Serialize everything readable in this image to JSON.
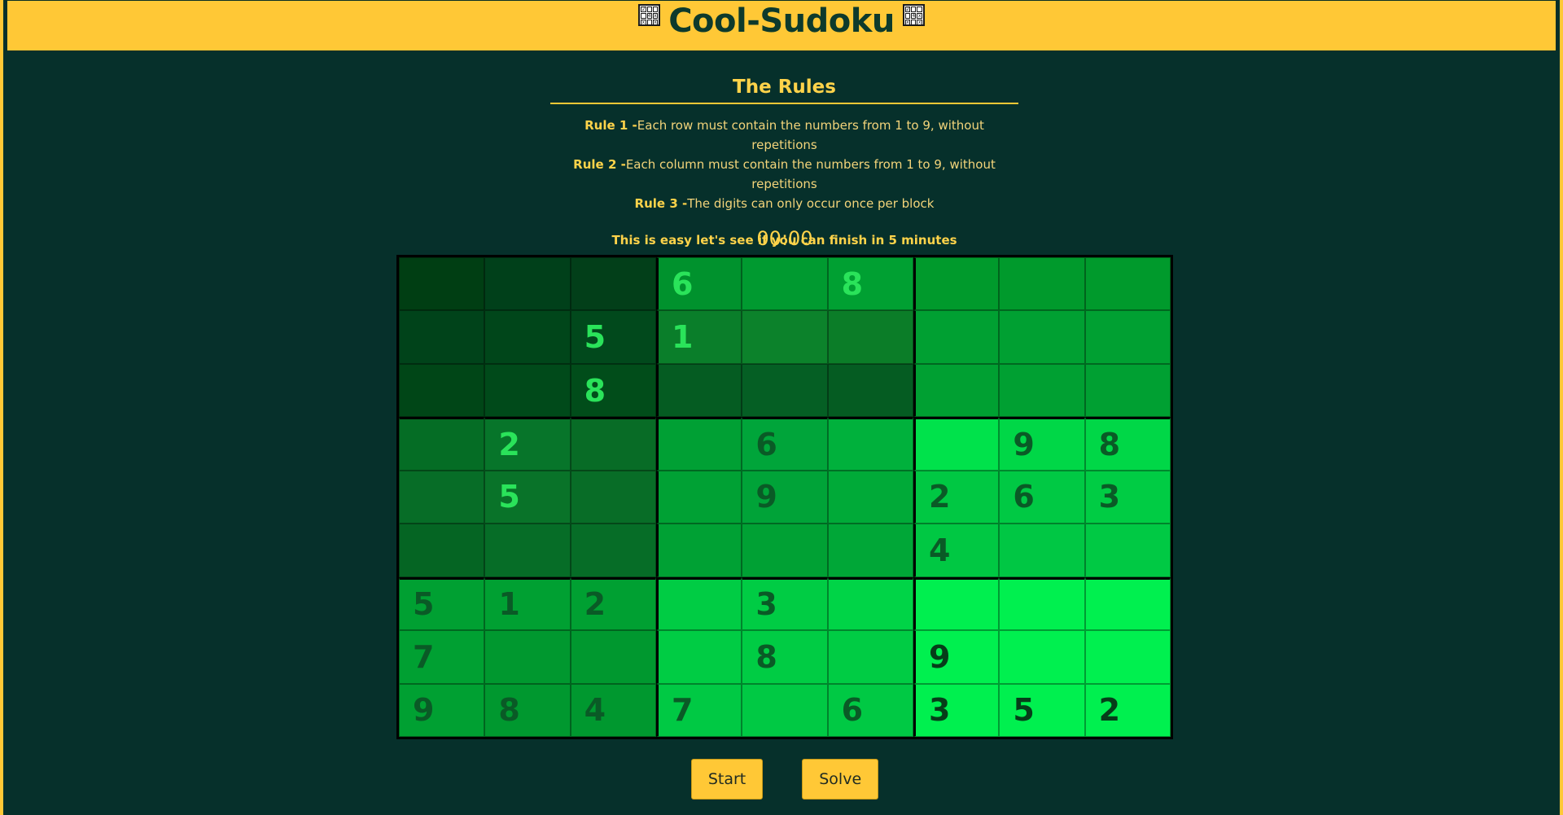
{
  "header": {
    "title": "Cool-Sudoku",
    "icon_glyphs": [
      "2",
      "",
      "",
      "",
      "4",
      "x",
      "x",
      "",
      "x"
    ]
  },
  "rules": {
    "title": "The Rules",
    "items": [
      {
        "label": "Rule 1 -",
        "text": "Each row must contain the numbers from 1 to 9, without repetitions"
      },
      {
        "label": "Rule 2 -",
        "text": "Each column must contain the numbers from 1 to 9, without repetitions"
      },
      {
        "label": "Rule 3 -",
        "text": "The digits can only occur once per block"
      }
    ],
    "tagline": "This is easy let's see if you can finish in 5 minutes"
  },
  "timer": "00:00",
  "board": {
    "cells": [
      [
        "",
        "",
        "",
        "6",
        "",
        "8",
        "",
        "",
        ""
      ],
      [
        "",
        "",
        "5",
        "1",
        "",
        "",
        "",
        "",
        ""
      ],
      [
        "",
        "",
        "8",
        "",
        "",
        "",
        "",
        "",
        ""
      ],
      [
        "",
        "2",
        "",
        "",
        "6",
        "",
        "",
        "9",
        "8"
      ],
      [
        "",
        "5",
        "",
        "",
        "9",
        "",
        "2",
        "6",
        "3"
      ],
      [
        "",
        "",
        "",
        "",
        "",
        "",
        "4",
        "",
        ""
      ],
      [
        "5",
        "1",
        "2",
        "",
        "3",
        "",
        "",
        "",
        ""
      ],
      [
        "7",
        "",
        "",
        "",
        "8",
        "",
        "9",
        "",
        ""
      ],
      [
        "9",
        "8",
        "4",
        "7",
        "",
        "6",
        "3",
        "5",
        "2"
      ]
    ],
    "palette": {
      "backgrounds": [
        "#003d14",
        "#00461a",
        "#055c22",
        "#045c21",
        "#00922d",
        "#00a03a",
        "#00b63a",
        "#00c745",
        "#00e84c",
        "#00d647",
        "#00cc44",
        "#00f04f"
      ],
      "digit_bright": "#2ae35a",
      "digit_dark": "#0a5a26"
    }
  },
  "buttons": {
    "start": "Start",
    "solve": "Solve"
  }
}
